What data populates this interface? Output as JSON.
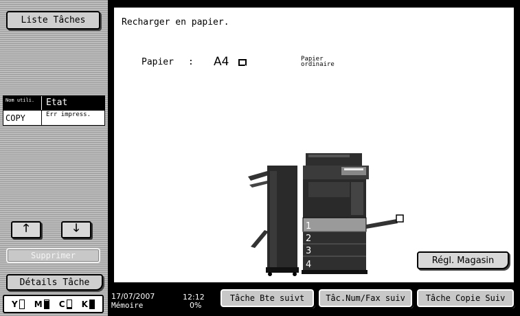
{
  "sidebar": {
    "tasks_button": "Liste Tâches",
    "table_headers": [
      "Nom utili.",
      "Etat"
    ],
    "rows": [
      {
        "user": "COPY",
        "state": "Err impress."
      }
    ],
    "arrow_up_icon": "arrow-up-icon",
    "arrow_down_icon": "arrow-down-icon",
    "delete_button": "Supprimer",
    "details_button": "Détails Tâche"
  },
  "toner": {
    "items": [
      {
        "label": "Y",
        "level_pct": 0
      },
      {
        "label": "M",
        "level_pct": 90
      },
      {
        "label": "C",
        "level_pct": 10
      },
      {
        "label": "K",
        "level_pct": 100
      }
    ]
  },
  "main": {
    "message": "Recharger en papier.",
    "paper_label": "Papier",
    "paper_colon": ":",
    "paper_size": "A4",
    "paper_type": "Papier ordinaire",
    "tray_numbers": [
      "1",
      "2",
      "3",
      "4"
    ],
    "magasin_button": "Régl. Magasin"
  },
  "status": {
    "date": "17/07/2007",
    "time": "12:12",
    "memory_label": "Mémoire",
    "memory_pct": "0%"
  },
  "bottom_tabs": [
    {
      "label": "Tâche Bte suivt"
    },
    {
      "label": "Tâc.Num/Fax suiv"
    },
    {
      "label": "Tâche Copie Suiv"
    }
  ]
}
